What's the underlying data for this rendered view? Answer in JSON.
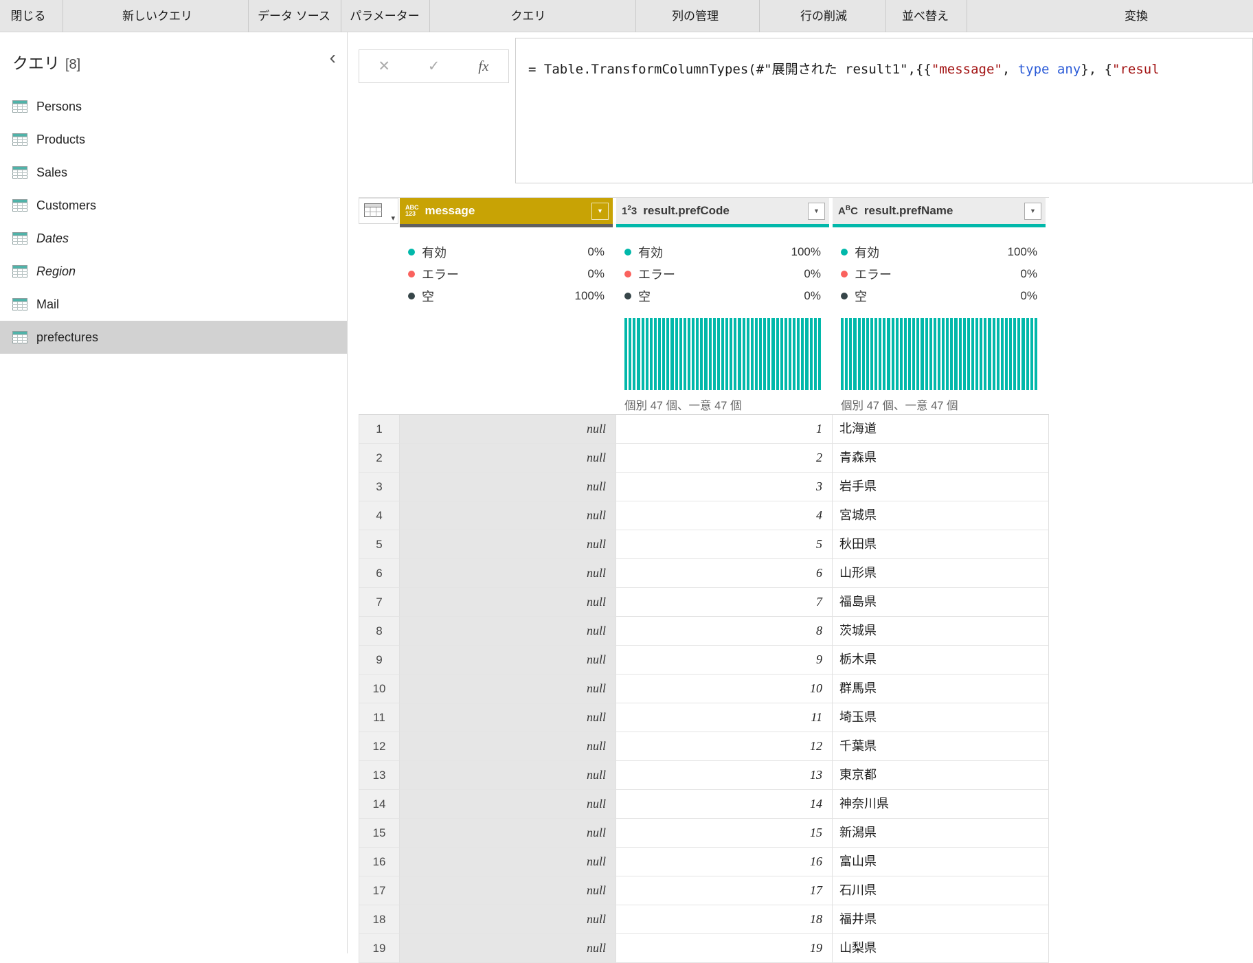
{
  "colors": {
    "accent_teal": "#01B8AA",
    "error_red": "#FA625E",
    "empty_gray": "#374649",
    "selected_header": "#C8A305",
    "message_quality_bar": "#606060",
    "selected_cell_bg": "#E6E6E6",
    "row_num_bg": "#F0F0F0"
  },
  "icons": {
    "filter_caret": "▼",
    "caret_down": "▾"
  },
  "ribbon": {
    "tabs": [
      "閉じる",
      "新しいクエリ",
      "データ ソース",
      "パラメーター",
      "クエリ",
      "列の管理",
      "行の削減",
      "並べ替え",
      "変換"
    ]
  },
  "sidebar": {
    "title": "クエリ",
    "count": "[8]",
    "collapse_icon": "‹",
    "items": [
      {
        "label": "Persons"
      },
      {
        "label": "Products"
      },
      {
        "label": "Sales"
      },
      {
        "label": "Customers"
      },
      {
        "label": "Dates"
      },
      {
        "label": "Region"
      },
      {
        "label": "Mail"
      },
      {
        "label": "prefectures"
      }
    ]
  },
  "formula_bar": {
    "cancel_icon": "✕",
    "commit_icon": "✓",
    "fx_icon": "fx",
    "segments": [
      {
        "text": "= Table.TransformColumnTypes(#\"展開された result1\",{{",
        "color": "#1E1E1E"
      },
      {
        "text": "\"message\"",
        "color": "#A31515"
      },
      {
        "text": ", ",
        "color": "#1E1E1E"
      },
      {
        "text": "type any",
        "color": "#2B5BD7"
      },
      {
        "text": "}, {",
        "color": "#1E1E1E"
      },
      {
        "text": "\"resul",
        "color": "#A31515"
      }
    ]
  },
  "table": {
    "quality_legend": {
      "valid": "有効",
      "error": "エラー",
      "empty": "空"
    },
    "columns": [
      {
        "name": "message",
        "selected": true,
        "type_icon": {
          "top": "ABC",
          "bottom": "123"
        },
        "valid_pct": "0%",
        "error_pct": "0%",
        "empty_pct": "100%",
        "histogram_bars": 0,
        "distinct_label": ""
      },
      {
        "name": "result.prefCode",
        "selected": false,
        "type_icon": {
          "pre": "1",
          "sup": "2",
          "post": "3"
        },
        "valid_pct": "100%",
        "error_pct": "0%",
        "empty_pct": "0%",
        "histogram_bars": 47,
        "distinct_label": "個別 47 個、一意 47 個"
      },
      {
        "name": "result.prefName",
        "selected": false,
        "type_icon": {
          "pre": "A",
          "sup": "B",
          "post": "C"
        },
        "valid_pct": "100%",
        "error_pct": "0%",
        "empty_pct": "0%",
        "histogram_bars": 47,
        "distinct_label": "個別 47 個、一意 47 個"
      }
    ],
    "rows": [
      {
        "num": "1",
        "message": "null",
        "prefCode": "1",
        "prefName": "北海道"
      },
      {
        "num": "2",
        "message": "null",
        "prefCode": "2",
        "prefName": "青森県"
      },
      {
        "num": "3",
        "message": "null",
        "prefCode": "3",
        "prefName": "岩手県"
      },
      {
        "num": "4",
        "message": "null",
        "prefCode": "4",
        "prefName": "宮城県"
      },
      {
        "num": "5",
        "message": "null",
        "prefCode": "5",
        "prefName": "秋田県"
      },
      {
        "num": "6",
        "message": "null",
        "prefCode": "6",
        "prefName": "山形県"
      },
      {
        "num": "7",
        "message": "null",
        "prefCode": "7",
        "prefName": "福島県"
      },
      {
        "num": "8",
        "message": "null",
        "prefCode": "8",
        "prefName": "茨城県"
      },
      {
        "num": "9",
        "message": "null",
        "prefCode": "9",
        "prefName": "栃木県"
      },
      {
        "num": "10",
        "message": "null",
        "prefCode": "10",
        "prefName": "群馬県"
      },
      {
        "num": "11",
        "message": "null",
        "prefCode": "11",
        "prefName": "埼玉県"
      },
      {
        "num": "12",
        "message": "null",
        "prefCode": "12",
        "prefName": "千葉県"
      },
      {
        "num": "13",
        "message": "null",
        "prefCode": "13",
        "prefName": "東京都"
      },
      {
        "num": "14",
        "message": "null",
        "prefCode": "14",
        "prefName": "神奈川県"
      },
      {
        "num": "15",
        "message": "null",
        "prefCode": "15",
        "prefName": "新潟県"
      },
      {
        "num": "16",
        "message": "null",
        "prefCode": "16",
        "prefName": "富山県"
      },
      {
        "num": "17",
        "message": "null",
        "prefCode": "17",
        "prefName": "石川県"
      },
      {
        "num": "18",
        "message": "null",
        "prefCode": "18",
        "prefName": "福井県"
      },
      {
        "num": "19",
        "message": "null",
        "prefCode": "19",
        "prefName": "山梨県"
      }
    ]
  }
}
